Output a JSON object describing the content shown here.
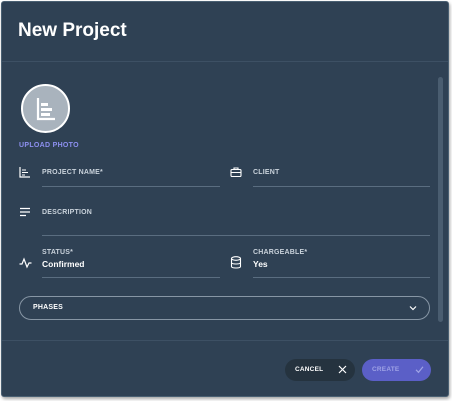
{
  "dialog": {
    "title": "New Project"
  },
  "photo": {
    "upload_label": "UPLOAD PHOTO",
    "icon": "project-chart-icon"
  },
  "fields": {
    "project_name": {
      "label": "PROJECT NAME*",
      "value": "",
      "icon": "chart-icon"
    },
    "client": {
      "label": "CLIENT",
      "value": "",
      "icon": "briefcase-icon"
    },
    "description": {
      "label": "DESCRIPTION",
      "value": "",
      "icon": "text-lines-icon"
    },
    "status": {
      "label": "STATUS*",
      "value": "Confirmed",
      "icon": "pulse-icon"
    },
    "chargeable": {
      "label": "CHARGEABLE*",
      "value": "Yes",
      "icon": "database-icon"
    }
  },
  "phases": {
    "label": "PHASES",
    "icon": "chevron-down-icon"
  },
  "footer": {
    "cancel_label": "CANCEL",
    "create_label": "CREATE"
  },
  "colors": {
    "background": "#2f4154",
    "accent": "#5b5fc7",
    "link": "#8d90f0"
  }
}
